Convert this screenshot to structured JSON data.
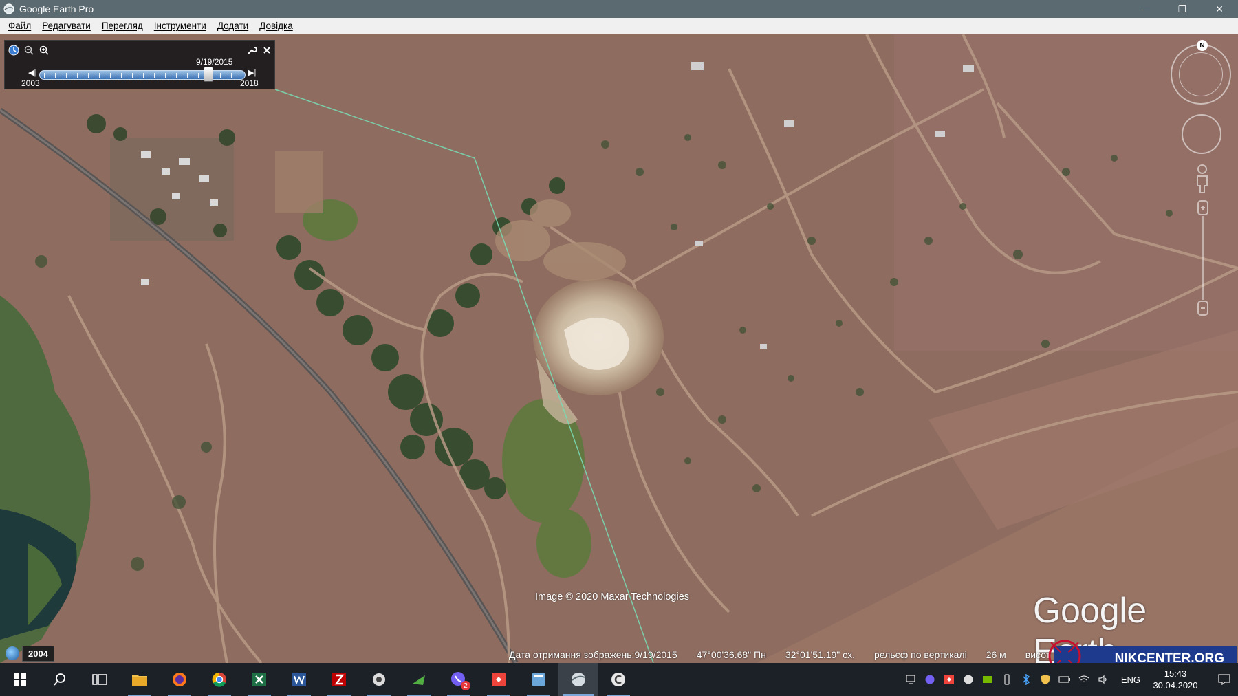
{
  "window": {
    "title": "Google Earth Pro",
    "icon": "google-earth-icon",
    "controls": [
      "minimize-icon",
      "restore-icon",
      "close-icon"
    ]
  },
  "menu": {
    "items": [
      "Файл",
      "Редагувати",
      "Перегляд",
      "Інструменти",
      "Додати",
      "Довідка"
    ]
  },
  "time_slider": {
    "selected_date": "9/19/2015",
    "start_year": "2003",
    "end_year": "2018",
    "position": 0.82,
    "icons": [
      "clock-icon",
      "zoom-out-time-icon",
      "zoom-in-time-icon",
      "wrench-icon",
      "close-icon",
      "step-back-icon",
      "step-forward-icon"
    ]
  },
  "navigation": {
    "north": "N",
    "icons": [
      "look-ring-icon",
      "move-ring-icon",
      "street-view-pegman-icon",
      "zoom-slider-icon"
    ]
  },
  "map": {
    "attribution": "Image © 2020 Maxar Technologies",
    "logo_text": "Google Earth"
  },
  "historical_imagery": {
    "year": "2004"
  },
  "status_bar": {
    "imagery_date": "Дата отримання зображень:9/19/2015",
    "latitude": "47°00'36.68\" Пн",
    "longitude": "32°01'51.19\" сх.",
    "terrain": "рельєф по вертикалі",
    "elevation": "26 м",
    "altitude_label": "висот"
  },
  "watermark": {
    "text": "NIKCENTER.ORG"
  },
  "taskbar": {
    "apps": [
      "start-icon",
      "search-icon",
      "task-view-icon",
      "file-explorer-icon",
      "firefox-icon",
      "chrome-icon",
      "excel-icon",
      "word-icon",
      "filezilla-icon",
      "app-icon",
      "app-play-icon",
      "viber-icon",
      "anydesk-icon",
      "calculator-icon",
      "google-earth-icon",
      "ccleaner-icon"
    ],
    "viber_badge": "2",
    "tray": {
      "language": "ENG",
      "time": "15:43",
      "date": "30.04.2020"
    }
  }
}
